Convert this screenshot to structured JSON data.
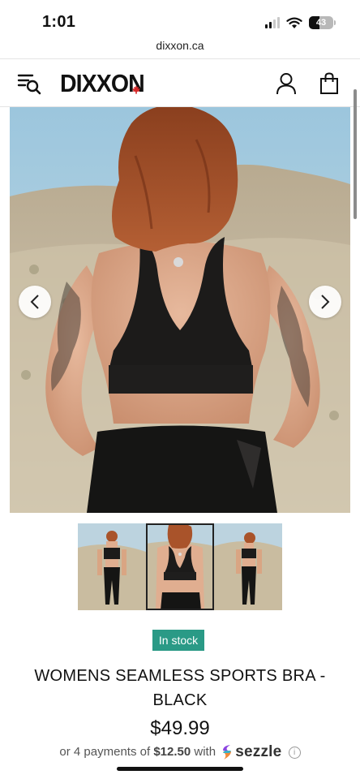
{
  "status_bar": {
    "time": "1:01",
    "battery": "43"
  },
  "browser": {
    "url": "dixxon.ca"
  },
  "header": {
    "logo": "DIXXON",
    "icons": [
      "menu-search-icon",
      "maple-leaf-icon",
      "account-icon",
      "shopping-bag-icon"
    ]
  },
  "gallery": {
    "image_alt": "Woman wearing black seamless sports bra and leggings, back view, desert landscape",
    "prev_icon": "chevron-left-icon",
    "next_icon": "chevron-right-icon",
    "thumbnails": [
      {
        "label": "front view"
      },
      {
        "label": "back view",
        "selected": true
      },
      {
        "label": "side view"
      }
    ]
  },
  "product": {
    "stock_status": "In stock",
    "title": "WOMENS SEAMLESS SPORTS BRA - BLACK",
    "price": "$49.99",
    "installments": {
      "prefix": "or 4 payments of",
      "amount": "$12.50",
      "suffix": "with",
      "provider": "sezzle"
    }
  },
  "colors": {
    "stock_badge": "#2a9a86",
    "text": "#111111"
  }
}
